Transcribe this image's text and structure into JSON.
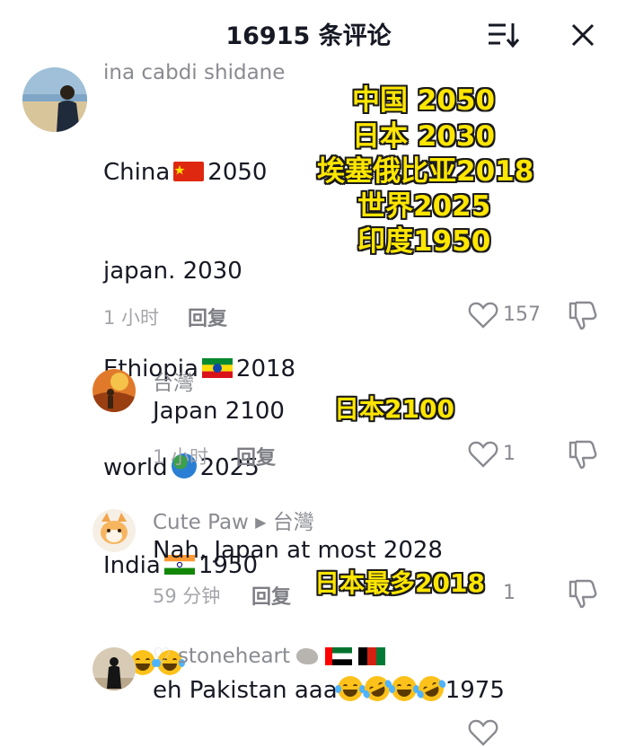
{
  "header": {
    "title": "16915 条评论",
    "sort_icon": "sort-icon",
    "close_icon": "close-icon"
  },
  "comments": [
    {
      "username": "ina cabdi shidane",
      "lines": [
        "China",
        "2050",
        "japan. 2030",
        "Ethiopia",
        "2018",
        "world",
        "2025",
        "India",
        "1950"
      ],
      "time": "1 小时",
      "reply_label": "回复",
      "likes": "157"
    },
    {
      "username": "台灣",
      "text": "Japan 2100",
      "time": "1 小时",
      "reply_label": "回复",
      "likes": "1"
    },
    {
      "username": "Cute Paw",
      "location": "台灣",
      "text": "Nah, Japan at most 2028",
      "time": "59 分钟",
      "reply_label": "回复",
      "likes": "1"
    },
    {
      "username": "stoneheart",
      "text_a": "eh Pakistan aaa",
      "text_b": "1975"
    }
  ],
  "overlays": {
    "o1": "中国 2050",
    "o2": "日本 2030",
    "o3": "埃塞俄比亚2018",
    "o4": "世界2025",
    "o5": "印度1950",
    "o6": "日本2100",
    "o7": "日本最多2018"
  },
  "colors": {
    "overlay_text": "#ffe600",
    "overlay_outline": "#1a1a1a",
    "secondary_text": "#8a8b91"
  }
}
